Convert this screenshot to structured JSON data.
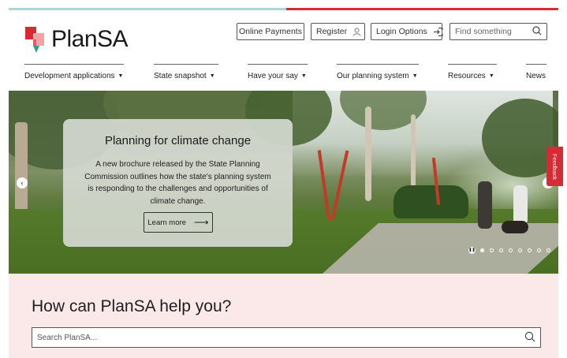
{
  "brand": {
    "name": "PlanSA"
  },
  "header": {
    "online_payments": "Online Payments",
    "register": "Register",
    "login_options": "Login Options",
    "search_placeholder": "Find something"
  },
  "nav": {
    "items": [
      {
        "label": "Development applications"
      },
      {
        "label": "State snapshot"
      },
      {
        "label": "Have your say"
      },
      {
        "label": "Our planning system"
      },
      {
        "label": "Resources"
      },
      {
        "label": "News"
      }
    ]
  },
  "hero": {
    "title": "Planning for climate change",
    "body": "A new brochure released by the State Planning Commission outlines how the state's planning system is responding to the challenges and opportunities of climate change.",
    "cta": "Learn more",
    "feedback": "Feedback",
    "slide_count": 8,
    "active_slide": 1
  },
  "help": {
    "title": "How can PlanSA help you?",
    "search_placeholder": "Search PlanSA..."
  },
  "colors": {
    "accent_red": "#d62b35",
    "accent_teal": "#a9d8d6",
    "help_bg": "#fbe9ea"
  }
}
